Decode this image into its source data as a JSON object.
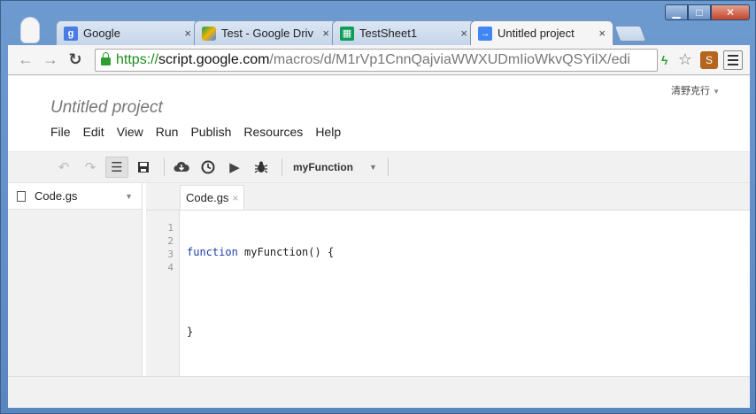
{
  "browser": {
    "tabs": [
      {
        "title": "Google",
        "favicon": "google-favicon",
        "favicon_color": "#4a7ce6"
      },
      {
        "title": "Test - Google Driv",
        "favicon": "drive-favicon",
        "favicon_color": "#f4b400"
      },
      {
        "title": "TestSheet1",
        "favicon": "sheets-favicon",
        "favicon_color": "#0f9d58"
      },
      {
        "title": "Untitled project",
        "favicon": "apps-script-favicon",
        "favicon_color": "#4285f4",
        "active": true
      }
    ],
    "url": {
      "scheme": "https://",
      "host": "script.google.com",
      "path": "/macros/d/M1rVp1CnnQajviaWWXUDmIioWkvQSYilX/edi"
    }
  },
  "app": {
    "user": "清野克行",
    "project_title": "Untitled project",
    "menu": [
      "File",
      "Edit",
      "View",
      "Run",
      "Publish",
      "Resources",
      "Help"
    ],
    "function_select": "myFunction",
    "files": [
      {
        "name": "Code.gs"
      }
    ],
    "open_tab": "Code.gs",
    "line_numbers": [
      "1",
      "2",
      "3",
      "4"
    ],
    "code_lines": [
      {
        "kw": "function",
        "rest": " myFunction() {"
      },
      {
        "kw": "",
        "rest": ""
      },
      {
        "kw": "",
        "rest": "}"
      },
      {
        "kw": "",
        "rest": ""
      }
    ]
  }
}
